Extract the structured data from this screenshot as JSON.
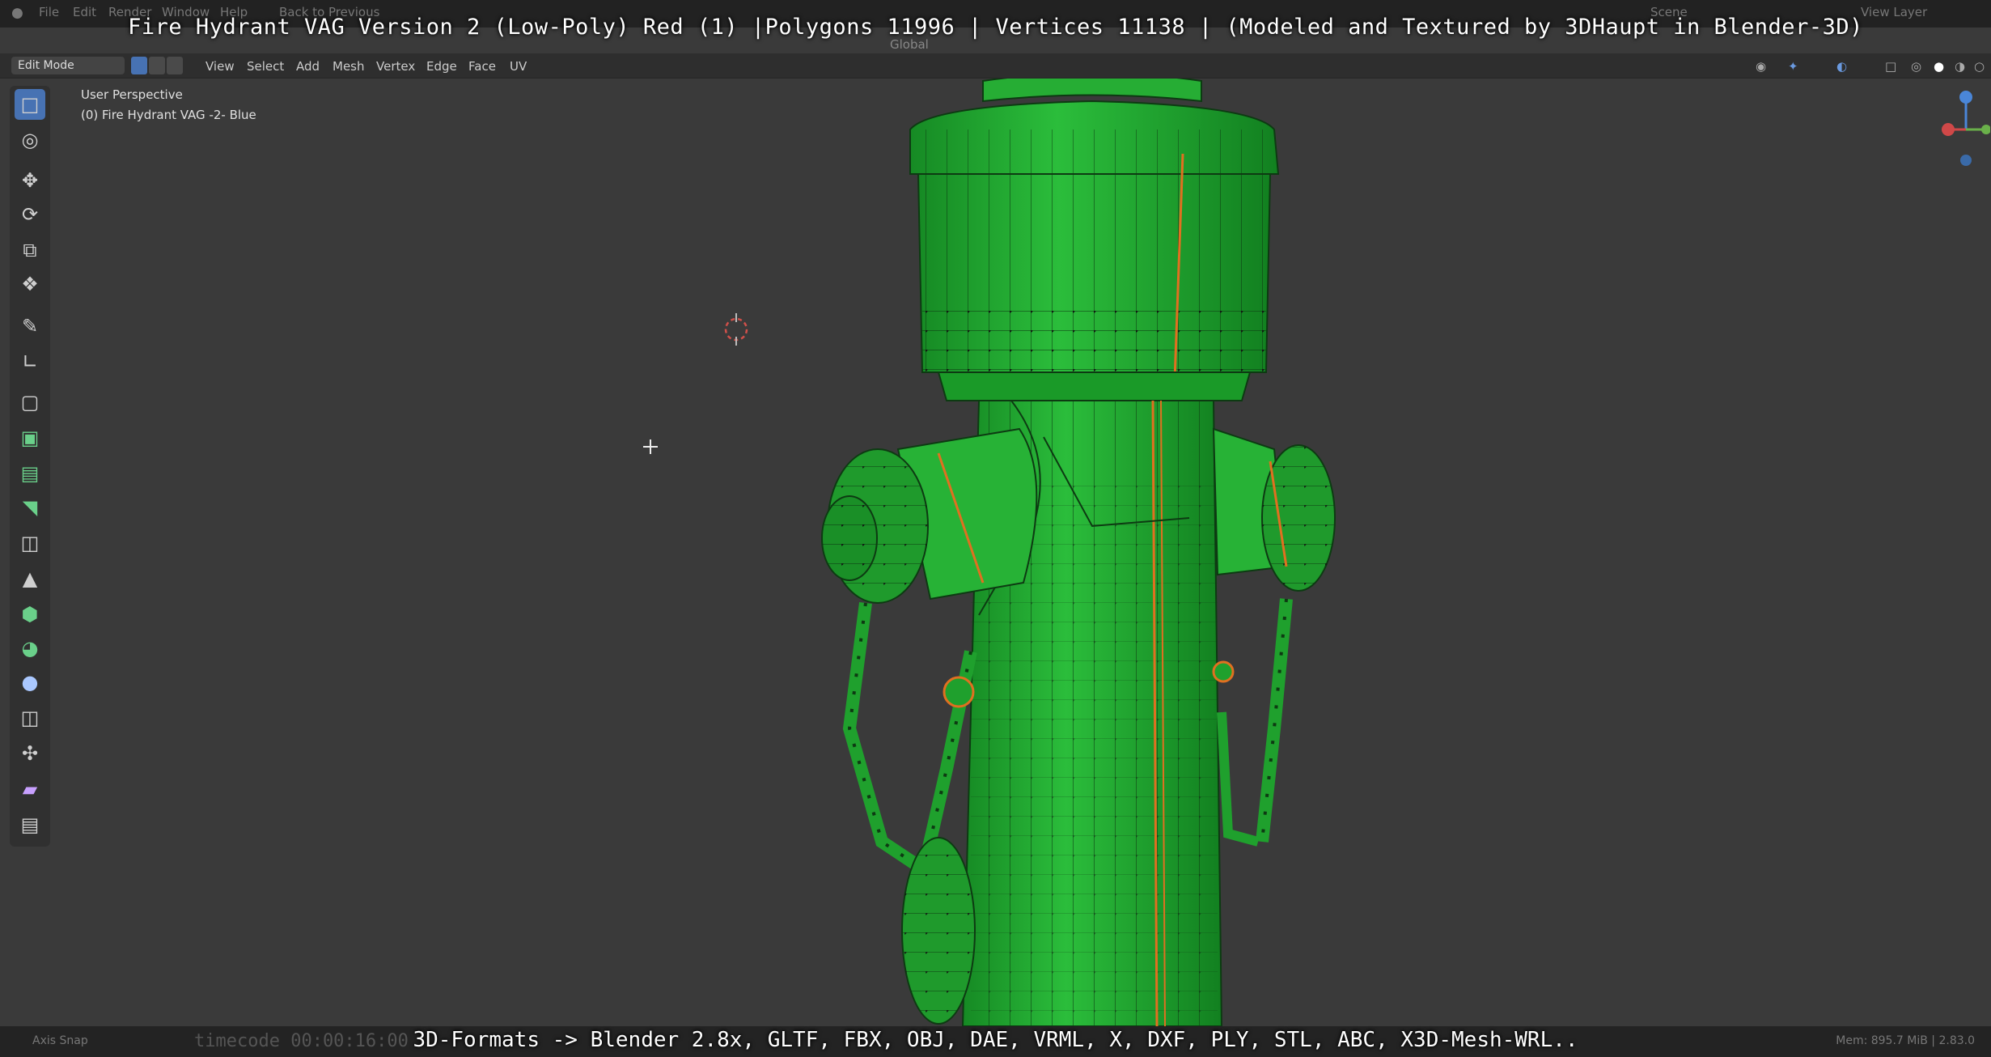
{
  "window": {
    "menus": [
      "File",
      "Edit",
      "Render",
      "Window",
      "Help"
    ],
    "back_button": "Back to Previous",
    "scene_label": "Scene",
    "view_layer_label": "View Layer"
  },
  "overlay": {
    "title": "Fire Hydrant VAG Version 2 (Low-Poly) Red (1) |Polygons 11996 | Vertices 11138 | (Modeled and Textured by 3DHaupt in Blender-3D)",
    "footer": "3D-Formats -> Blender 2.8x, GLTF, FBX, OBJ, DAE, VRML, X, DXF, PLY, STL, ABC, X3D-Mesh-WRL.."
  },
  "header": {
    "mode": "Edit Mode",
    "menu": [
      "View",
      "Select",
      "Add",
      "Mesh",
      "Vertex",
      "Edge",
      "Face",
      "UV"
    ],
    "transform_orientation": "Global"
  },
  "viewport": {
    "perspective": "User Perspective",
    "object_name": "(0) Fire Hydrant VAG -2- Blue"
  },
  "toolbar": {
    "tools": [
      "select-box",
      "cursor",
      "move",
      "rotate",
      "scale",
      "transform",
      "annotate",
      "measure",
      "add-cube",
      "extrude",
      "inset",
      "bevel",
      "loop-cut",
      "knife",
      "poly-build",
      "spin",
      "smooth",
      "edge-slide",
      "shrink-fatten",
      "shear",
      "rip"
    ]
  },
  "statusbar": {
    "left": "Axis Snap",
    "timecode": "timecode 00:00:16:00",
    "right": "Mem: 895.7 MiB | 2.83.0"
  },
  "colors": {
    "mesh": "#22a832",
    "mesh_dark": "#137a1f",
    "seam": "#e07020",
    "accent": "#4772b3"
  }
}
